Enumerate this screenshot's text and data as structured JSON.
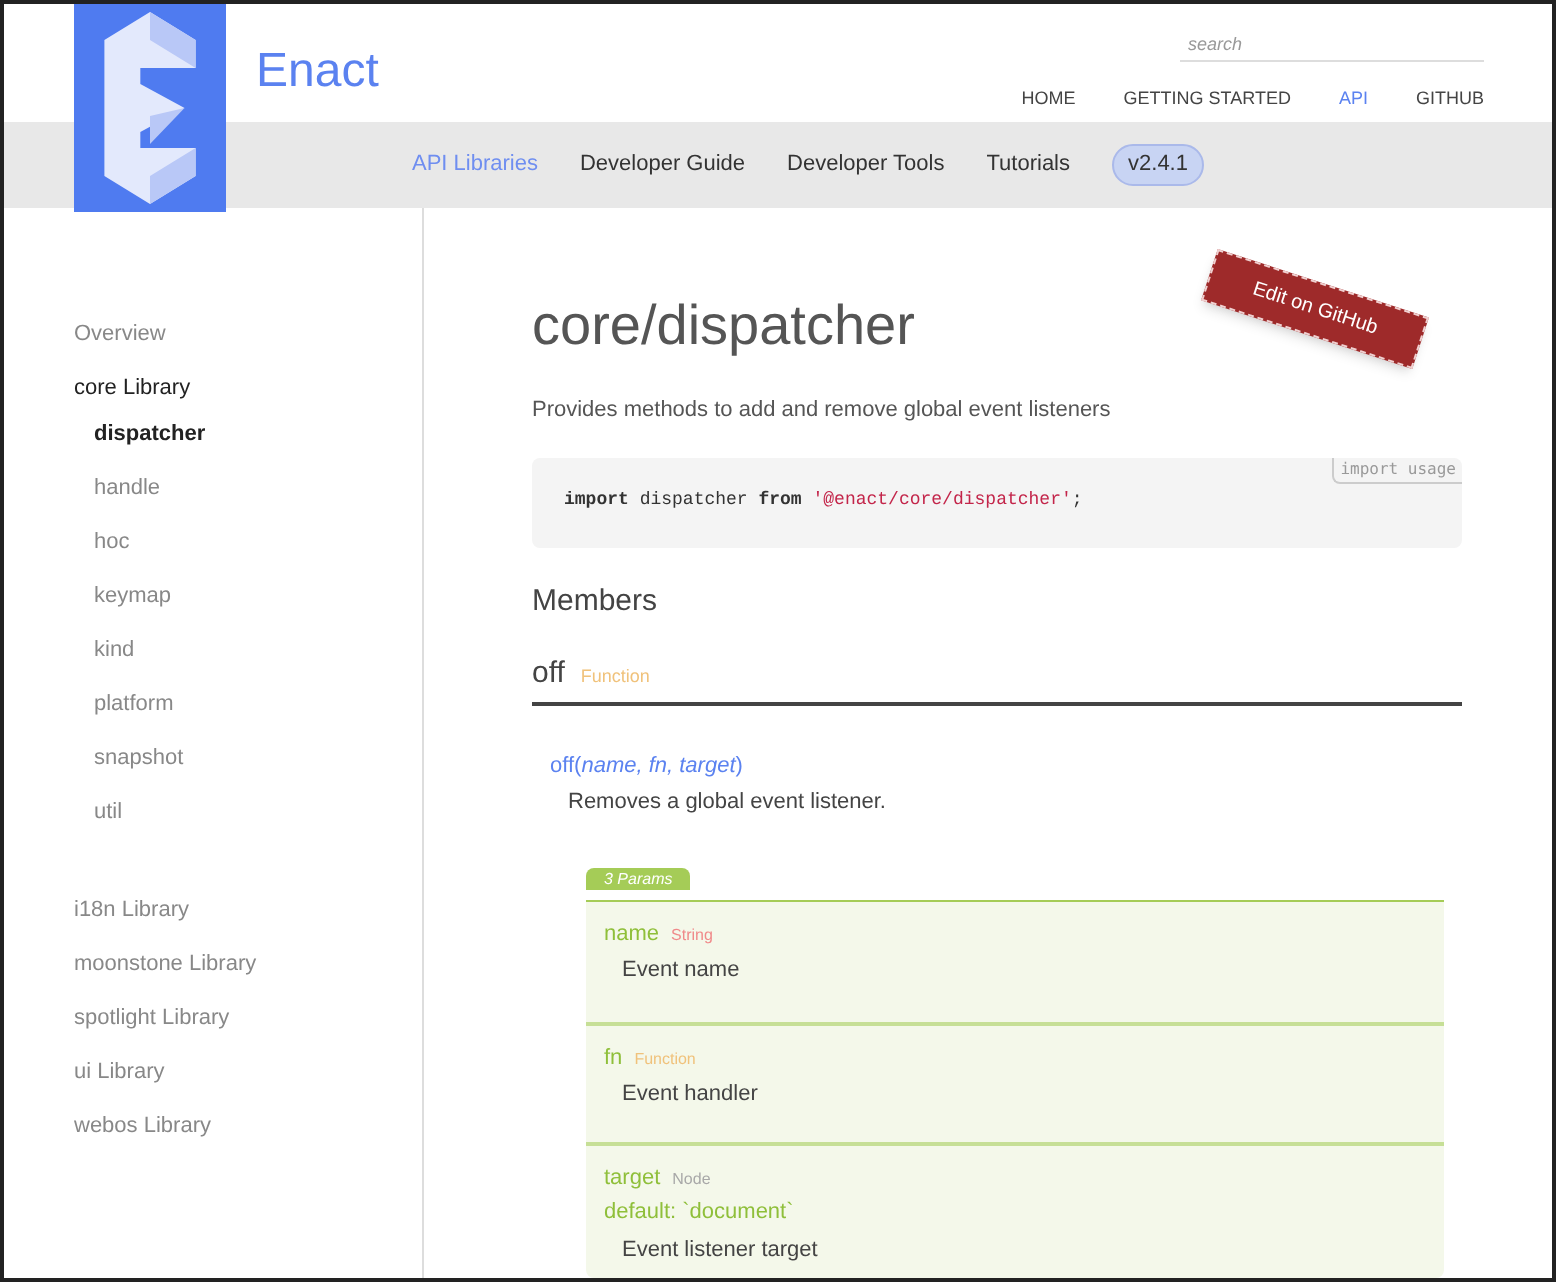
{
  "header": {
    "brand": "Enact",
    "search": {
      "placeholder": "search"
    },
    "top_nav": [
      {
        "label": "HOME",
        "selected": false
      },
      {
        "label": "GETTING STARTED",
        "selected": false
      },
      {
        "label": "API",
        "selected": true
      },
      {
        "label": "GITHUB",
        "selected": false
      }
    ],
    "sub_nav": [
      {
        "label": "API Libraries",
        "selected": true
      },
      {
        "label": "Developer Guide",
        "selected": false
      },
      {
        "label": "Developer Tools",
        "selected": false
      },
      {
        "label": "Tutorials",
        "selected": false
      }
    ],
    "version": "v2.4.1"
  },
  "sidebar": {
    "items": [
      {
        "label": "Overview",
        "selected": false
      },
      {
        "label": "core Library",
        "selected": true,
        "children": [
          {
            "label": "dispatcher",
            "selected": true
          },
          {
            "label": "handle",
            "selected": false
          },
          {
            "label": "hoc",
            "selected": false
          },
          {
            "label": "keymap",
            "selected": false
          },
          {
            "label": "kind",
            "selected": false
          },
          {
            "label": "platform",
            "selected": false
          },
          {
            "label": "snapshot",
            "selected": false
          },
          {
            "label": "util",
            "selected": false
          }
        ]
      },
      {
        "label": "i18n Library",
        "selected": false
      },
      {
        "label": "moonstone Library",
        "selected": false
      },
      {
        "label": "spotlight Library",
        "selected": false
      },
      {
        "label": "ui Library",
        "selected": false
      },
      {
        "label": "webos Library",
        "selected": false
      }
    ]
  },
  "content": {
    "title": "core/dispatcher",
    "edit_ribbon": "Edit on GitHub",
    "description": "Provides methods to add and remove global event listeners",
    "code": {
      "tab": "import usage",
      "keyword1": "import",
      "ident": "dispatcher",
      "keyword2": "from",
      "string": "'@enact/core/dispatcher'",
      "end": ";"
    },
    "members_heading": "Members",
    "member": {
      "name": "off",
      "type": "Function",
      "signature": "off(*name, fn, target*)",
      "description": "Removes a global event listener.",
      "params_tab": "3 Params",
      "params": [
        {
          "name": "name",
          "type": "String",
          "color": "#f08a8a",
          "description": "Event name"
        },
        {
          "name": "fn",
          "type": "Function",
          "color": "#f0c27b",
          "description": "Event handler"
        },
        {
          "name": "target",
          "type": "Node",
          "color": "#a8a8a8",
          "default": "default: `document`",
          "description": "Event listener target"
        }
      ]
    }
  }
}
